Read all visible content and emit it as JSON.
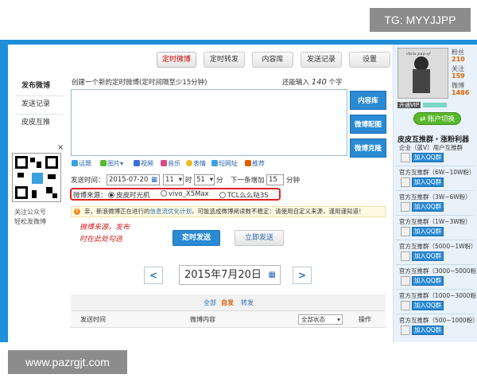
{
  "overlay": {
    "tg": "TG: MYYJJPP",
    "site": "www.pazrgjt.com"
  },
  "tabs": [
    {
      "label": "定时微博",
      "active": true
    },
    {
      "label": "定时转发"
    },
    {
      "label": "内容库"
    },
    {
      "label": "发送记录"
    },
    {
      "label": "设置"
    }
  ],
  "nav": {
    "items": [
      "发布微博",
      "发送记录",
      "皮皮互推"
    ]
  },
  "qr": {
    "caption1": "关注公众号",
    "caption2": "轻松发微博",
    "close": "×"
  },
  "compose": {
    "hint": "创建一个新的定时微博(定时间隔至少15分钟)",
    "count_prefix": "还能输入",
    "count_value": "140",
    "count_suffix": "个字",
    "side_buttons": [
      "内容库",
      "微博配图",
      "微博克隆"
    ]
  },
  "toolbar": [
    "话题",
    "图片",
    "视频",
    "音乐",
    "表情",
    "短网址",
    "推荐"
  ],
  "time": {
    "label": "发送时间：",
    "date": "2015-07-20",
    "hour": "11",
    "hour_unit": "时",
    "minute": "51",
    "minute_unit": "分",
    "next_label": "下一条增加",
    "increment": "15",
    "increment_unit": "分钟"
  },
  "source": {
    "label": "微博来源：",
    "options": [
      "皮皮时光机",
      "vivo_X5Max",
      "TCL么么哒3S"
    ],
    "selected": 0
  },
  "warning": {
    "prefix": "亲，新浪微博正在进行的",
    "link": "信息流优化计划",
    "suffix": "，可能造成微博阅读数不稳定：请使用自定义来源，谨用谨知道！"
  },
  "annotation": {
    "line1": "微博来源，发布",
    "line2": "时在此处勾选"
  },
  "actions": {
    "send_timed": "定时发送",
    "send_now": "立即发送"
  },
  "date_nav": {
    "date": "2015年7月20日",
    "prev": "<",
    "next": ">"
  },
  "filters": [
    "全部",
    "自发",
    "转发"
  ],
  "table": {
    "headers": [
      "发送时间",
      "微博内容",
      "操作"
    ],
    "status_select": "全部状态"
  },
  "profile": {
    "stats": [
      {
        "label": "粉丝",
        "value": "210"
      },
      {
        "label": "关注",
        "value": "159"
      },
      {
        "label": "微博",
        "value": "1486"
      }
    ],
    "vip": "开通VIP",
    "switch_label": "账户切换"
  },
  "promo": {
    "title": "皮皮互推群・涨粉利器",
    "groups": [
      "企业（蓝V）用户互推群",
      "官方互推群（6W~10W粉）",
      "官方互推群（3W~6W粉）",
      "官方互推群（1W~3W粉）",
      "官方互推群（5000~1W粉）",
      "官方互推群（3000~5000粉）",
      "官方互推群（1000~3000粉）",
      "官方互推群（500~1000粉）"
    ],
    "qq_label": "加入QQ群"
  },
  "colors": {
    "accent": "#2a8ad4",
    "warning_red": "#e02020",
    "switch_green": "#58b82a"
  }
}
